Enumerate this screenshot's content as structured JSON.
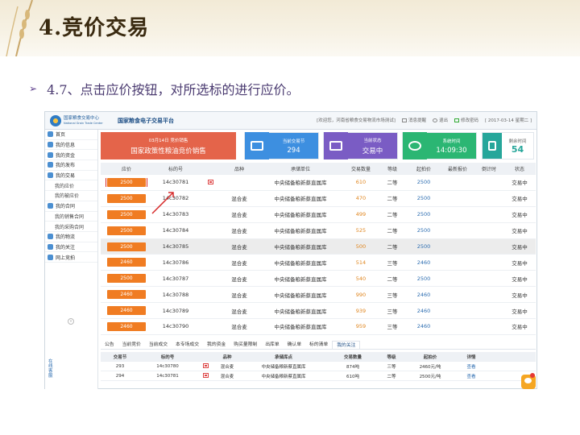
{
  "slide": {
    "title": "4.竞价交易",
    "subtitle": "4.7、点击应价按钮，对所选标的进行应价。"
  },
  "app": {
    "logo_line1": "国家粮食交易中心",
    "logo_line2": "National Grain Trade Center",
    "system_title": "国家粮食电子交易平台",
    "header_links": [
      "[欢迎您，河南省粮食交易物流市场测试]",
      "消息提醒",
      "退出",
      "修改密码",
      "[ 2017-03-14 星期二 ]"
    ]
  },
  "sidebar": {
    "items": [
      {
        "label": "首页",
        "sub": false
      },
      {
        "label": "我的信息",
        "sub": false
      },
      {
        "label": "我的资金",
        "sub": false
      },
      {
        "label": "我的发布",
        "sub": false
      },
      {
        "label": "我的交易",
        "sub": false
      },
      {
        "label": "我的应价",
        "sub": true
      },
      {
        "label": "我的被应价",
        "sub": true
      },
      {
        "label": "我的合同",
        "sub": false
      },
      {
        "label": "我的销售合同",
        "sub": true
      },
      {
        "label": "我的采购合同",
        "sub": true
      },
      {
        "label": "我的物流",
        "sub": false
      },
      {
        "label": "我的关注",
        "sub": false
      },
      {
        "label": "网上竞拍",
        "sub": false
      }
    ],
    "toggle": "«",
    "vertical_label": "在线客服"
  },
  "cards": {
    "session": {
      "line1": "03月14日 竞价销售",
      "line2": "国家政策性粮油竞价销售"
    },
    "current_lot": {
      "label": "当前交易节",
      "value": "294",
      "color": "#3d8fe0"
    },
    "current_status": {
      "label": "当前状态",
      "value": "交易中",
      "color": "#7a5cc4"
    },
    "system_time": {
      "label": "系统时间",
      "value": "14:09:30",
      "color": "#2bb673"
    },
    "remaining": {
      "label": "剩余时间",
      "value": "54",
      "color": "#26a69a"
    }
  },
  "table": {
    "headers": [
      "应价",
      "标的号",
      "品种",
      "承储单位",
      "交易数量",
      "等级",
      "起拍价",
      "最新报价",
      "倒计时",
      "状态"
    ],
    "rows": [
      {
        "bid": "2500",
        "lot": "14c30781",
        "variety": "",
        "flag": true,
        "unit": "中央储备粮新蔡直属库",
        "qty": "610",
        "grade": "二等",
        "start": "2500",
        "latest": "",
        "countdown": "",
        "status": "交易中"
      },
      {
        "bid": "2500",
        "lot": "14c30782",
        "variety": "混合麦",
        "flag": false,
        "unit": "中央储备粮新蔡直属库",
        "qty": "470",
        "grade": "二等",
        "start": "2500",
        "latest": "",
        "countdown": "",
        "status": "交易中"
      },
      {
        "bid": "2500",
        "lot": "14c30783",
        "variety": "混合麦",
        "flag": false,
        "unit": "中央储备粮新蔡直属库",
        "qty": "499",
        "grade": "二等",
        "start": "2500",
        "latest": "",
        "countdown": "",
        "status": "交易中"
      },
      {
        "bid": "2500",
        "lot": "14c30784",
        "variety": "混合麦",
        "flag": false,
        "unit": "中央储备粮新蔡直属库",
        "qty": "525",
        "grade": "二等",
        "start": "2500",
        "latest": "",
        "countdown": "",
        "status": "交易中"
      },
      {
        "bid": "2500",
        "lot": "14c30785",
        "variety": "混合麦",
        "flag": false,
        "unit": "中央储备粮新蔡直属库",
        "qty": "500",
        "grade": "二等",
        "start": "2500",
        "latest": "",
        "countdown": "",
        "status": "交易中"
      },
      {
        "bid": "2460",
        "lot": "14c30786",
        "variety": "混合麦",
        "flag": false,
        "unit": "中央储备粮新蔡直属库",
        "qty": "514",
        "grade": "三等",
        "start": "2460",
        "latest": "",
        "countdown": "",
        "status": "交易中"
      },
      {
        "bid": "2500",
        "lot": "14c30787",
        "variety": "混合麦",
        "flag": false,
        "unit": "中央储备粮新蔡直属库",
        "qty": "540",
        "grade": "二等",
        "start": "2500",
        "latest": "",
        "countdown": "",
        "status": "交易中"
      },
      {
        "bid": "2460",
        "lot": "14c30788",
        "variety": "混合麦",
        "flag": false,
        "unit": "中央储备粮新蔡直属库",
        "qty": "990",
        "grade": "三等",
        "start": "2460",
        "latest": "",
        "countdown": "",
        "status": "交易中"
      },
      {
        "bid": "2460",
        "lot": "14c30789",
        "variety": "混合麦",
        "flag": false,
        "unit": "中央储备粮新蔡直属库",
        "qty": "939",
        "grade": "三等",
        "start": "2460",
        "latest": "",
        "countdown": "",
        "status": "交易中"
      },
      {
        "bid": "2460",
        "lot": "14c30790",
        "variety": "混合麦",
        "flag": false,
        "unit": "中央储备粮新蔡直属库",
        "qty": "959",
        "grade": "三等",
        "start": "2460",
        "latest": "",
        "countdown": "",
        "status": "交易中"
      }
    ]
  },
  "tabs": [
    "公告",
    "当前竞价",
    "当前成交",
    "本专场成交",
    "我的资金",
    "购买量限制",
    "出库单",
    "确认单",
    "标的清单",
    "我的关注"
  ],
  "active_tab": "我的关注",
  "watch_table": {
    "headers": [
      "交易节",
      "标的号",
      "",
      "品种",
      "承储库点",
      "交易数量",
      "等级",
      "起拍价",
      "详情"
    ],
    "rows": [
      {
        "session": "293",
        "lot": "14c30780",
        "variety": "混合麦",
        "depot": "中央储备粮新蔡直属库",
        "qty": "874吨",
        "grade": "三等",
        "start": "2460元/吨",
        "detail": "查看"
      },
      {
        "session": "294",
        "lot": "14c30781",
        "variety": "混合麦",
        "depot": "中央储备粮新蔡直属库",
        "qty": "610吨",
        "grade": "二等",
        "start": "2500元/吨",
        "detail": "查看"
      }
    ]
  }
}
